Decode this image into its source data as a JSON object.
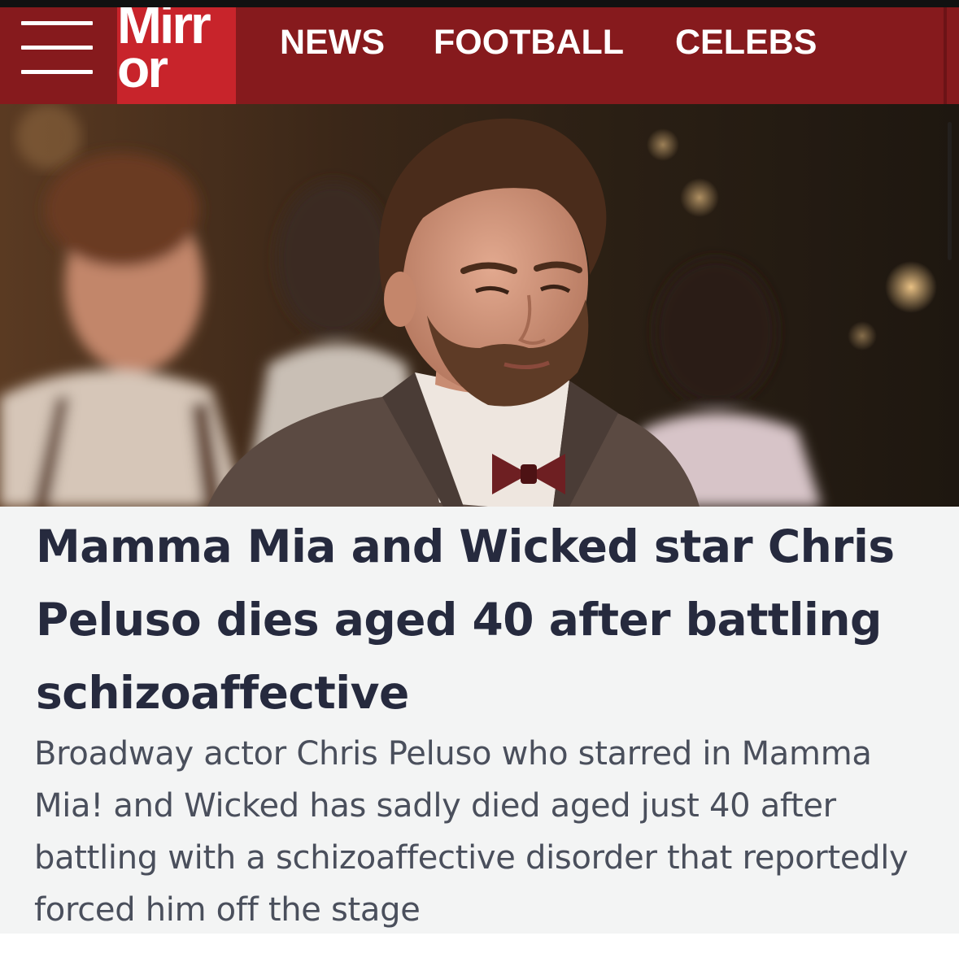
{
  "header": {
    "logo": {
      "line1": "Mirr",
      "line2": "or"
    },
    "nav": [
      {
        "label": "NEWS"
      },
      {
        "label": "FOOTBALL"
      },
      {
        "label": "CELEBS"
      }
    ],
    "menu_icon": "hamburger-menu-icon"
  },
  "colors": {
    "header_bg": "#861a1d",
    "logo_bg": "#c8242b",
    "headline_text": "#262a3e",
    "standfirst_text": "#4a4f5c",
    "article_bg": "#f3f4f4"
  },
  "article": {
    "headline": "Mamma Mia and Wicked star Chris Peluso dies aged 40 after battling schizoaffective",
    "standfirst": "Broadway actor Chris Peluso who starred in Mamma Mia! and Wicked has sadly died aged just 40 after battling with a schizoaffective disorder that reportedly forced him off the stage"
  }
}
